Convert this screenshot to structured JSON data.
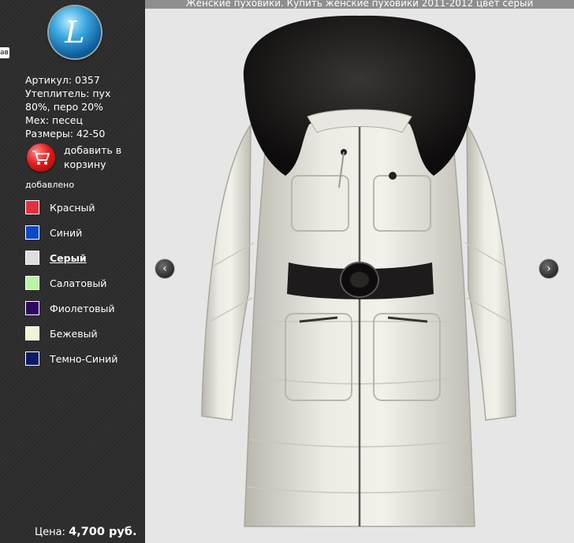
{
  "logo": {
    "glyph": "L",
    "icon": "logo-emblem-icon"
  },
  "edge_tab": {
    "text": "ав"
  },
  "product": {
    "article": "Артикул: 0357",
    "filling_line1": "Утеплитель: пух",
    "filling_line2": "80%, перо 20%",
    "fur": "Мех: песец",
    "sizes": "Размеры: 42-50"
  },
  "cart": {
    "label": "добавить в корзину",
    "icon": "shopping-cart-icon"
  },
  "added_text": "добавлено",
  "colors": [
    {
      "name": "Красный",
      "hex": "#e0323e",
      "selected": false
    },
    {
      "name": "Синий",
      "hex": "#0e49c4",
      "selected": false
    },
    {
      "name": "Серый",
      "hex": "#dcdce3",
      "selected": true
    },
    {
      "name": "Салатовый",
      "hex": "#b8f5a6",
      "selected": false
    },
    {
      "name": "Фиолетовый",
      "hex": "#2d0760",
      "selected": false
    },
    {
      "name": "Бежевый",
      "hex": "#f5f3d6",
      "selected": false
    },
    {
      "name": "Темно-Синий",
      "hex": "#0d1a63",
      "selected": false
    }
  ],
  "price": {
    "label": "Цена:",
    "value": "4,700 руб."
  },
  "title": "Женские пуховики. Купить женские пуховики 2011-2012 цвет серый",
  "nav": {
    "prev_icon": "chevron-left-icon",
    "next_icon": "chevron-right-icon"
  },
  "image": {
    "subject": "coat-image"
  }
}
